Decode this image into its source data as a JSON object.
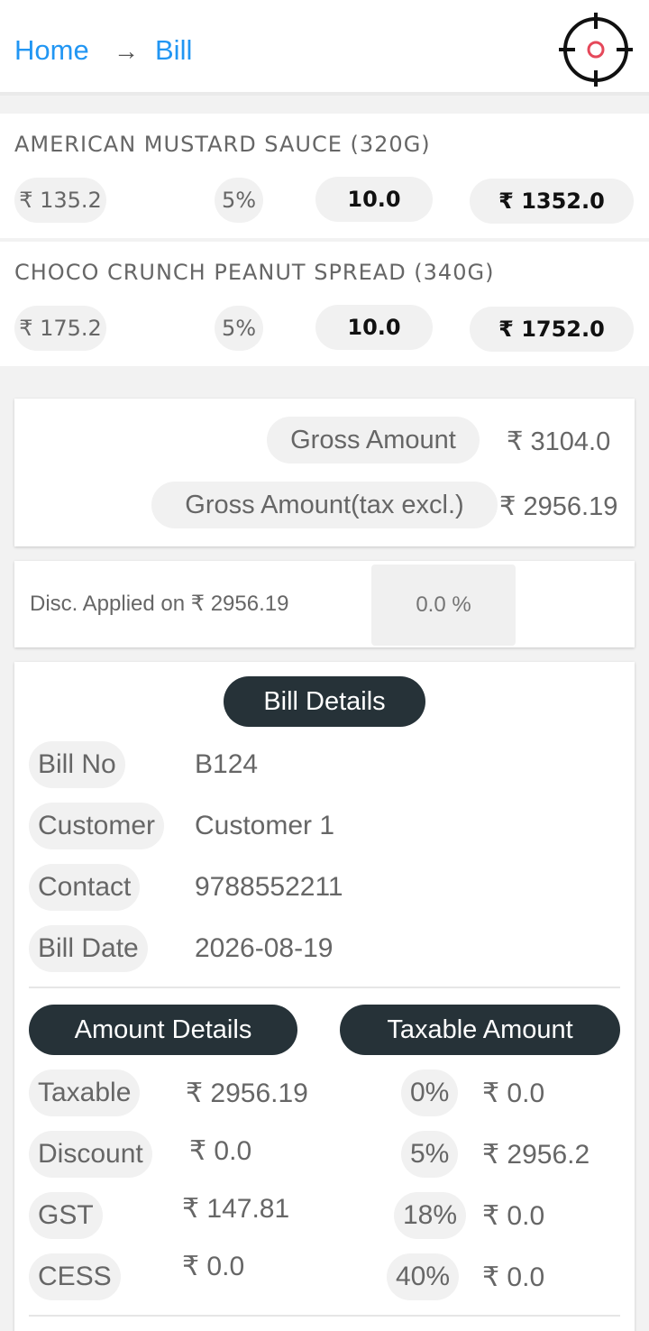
{
  "header": {
    "breadcrumb": {
      "home": "Home",
      "separator": "→",
      "current": "Bill"
    },
    "scan_icon": "target-scan-icon",
    "accent_color": "#2196f3",
    "scan_dot_color": "#e5485a"
  },
  "items": [
    {
      "name": "AMERICAN MUSTARD SAUCE (320G)",
      "price": "₹ 135.2",
      "tax": "5%",
      "qty": "10.0",
      "total": "₹ 1352.0"
    },
    {
      "name": "CHOCO CRUNCH PEANUT SPREAD (340G)",
      "price": "₹ 175.2",
      "tax": "5%",
      "qty": "10.0",
      "total": "₹ 1752.0"
    }
  ],
  "gross": {
    "gross_label": "Gross Amount",
    "gross_value": "₹ 3104.0",
    "excl_label": "Gross Amount(tax excl.)",
    "excl_value": "₹ 2956.19"
  },
  "discount": {
    "label": "Disc. Applied on ₹ 2956.19",
    "value": "0.0 %"
  },
  "bill_details": {
    "title": "Bill Details",
    "rows": [
      {
        "label": "Bill No",
        "value": "B124"
      },
      {
        "label": "Customer",
        "value": "Customer 1"
      },
      {
        "label": "Contact",
        "value": "9788552211"
      },
      {
        "label": "Bill Date",
        "value": "2026-08-19"
      }
    ]
  },
  "amount_details": {
    "title": "Amount Details",
    "rows": [
      {
        "label": "Taxable",
        "value": "₹ 2956.19"
      },
      {
        "label": "Discount",
        "value": "₹ 0.0"
      },
      {
        "label": "GST",
        "value": "₹ 147.81"
      },
      {
        "label": "CESS",
        "value": "₹ 0.0"
      }
    ]
  },
  "taxable_amount": {
    "title": "Taxable Amount",
    "rows": [
      {
        "rate": "0%",
        "value": "₹ 0.0"
      },
      {
        "rate": "5%",
        "value": "₹ 2956.2"
      },
      {
        "rate": "18%",
        "value": "₹ 0.0"
      },
      {
        "rate": "40%",
        "value": "₹ 0.0"
      }
    ]
  }
}
